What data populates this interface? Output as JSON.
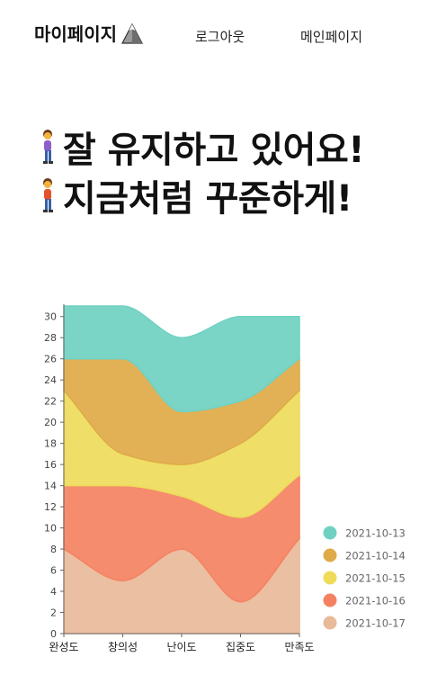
{
  "nav": {
    "brand": "마이페이지",
    "brand_icon": "mountain-icon",
    "logout": "로그아웃",
    "main_page": "메인페이지"
  },
  "hero": {
    "line1": "잘 유지하고 있어요!",
    "line2": "지금처럼 꾸준하게!",
    "line1_icon": "person-walking-icon",
    "line2_icon": "person-walking-icon"
  },
  "chart_data": {
    "type": "area",
    "stacked": true,
    "curve": "smooth",
    "categories": [
      "완성도",
      "창의성",
      "난이도",
      "집중도",
      "만족도"
    ],
    "ylim": [
      0,
      31
    ],
    "yticks": [
      0,
      2,
      4,
      6,
      8,
      10,
      12,
      14,
      16,
      18,
      20,
      22,
      24,
      26,
      28,
      30
    ],
    "grid": false,
    "legend_position": "bottom-right",
    "series": [
      {
        "name": "2021-10-17",
        "color": "#E9BA99",
        "values": [
          8,
          5,
          8,
          3,
          9
        ]
      },
      {
        "name": "2021-10-16",
        "color": "#F48262",
        "values": [
          6,
          9,
          5,
          8,
          6
        ]
      },
      {
        "name": "2021-10-15",
        "color": "#EEDB5A",
        "values": [
          9,
          3,
          3,
          7,
          8
        ]
      },
      {
        "name": "2021-10-14",
        "color": "#DFAA48",
        "values": [
          3,
          9,
          5,
          4,
          3
        ]
      },
      {
        "name": "2021-10-13",
        "color": "#70D1C2",
        "values": [
          5,
          5,
          7,
          8,
          4
        ]
      }
    ]
  }
}
